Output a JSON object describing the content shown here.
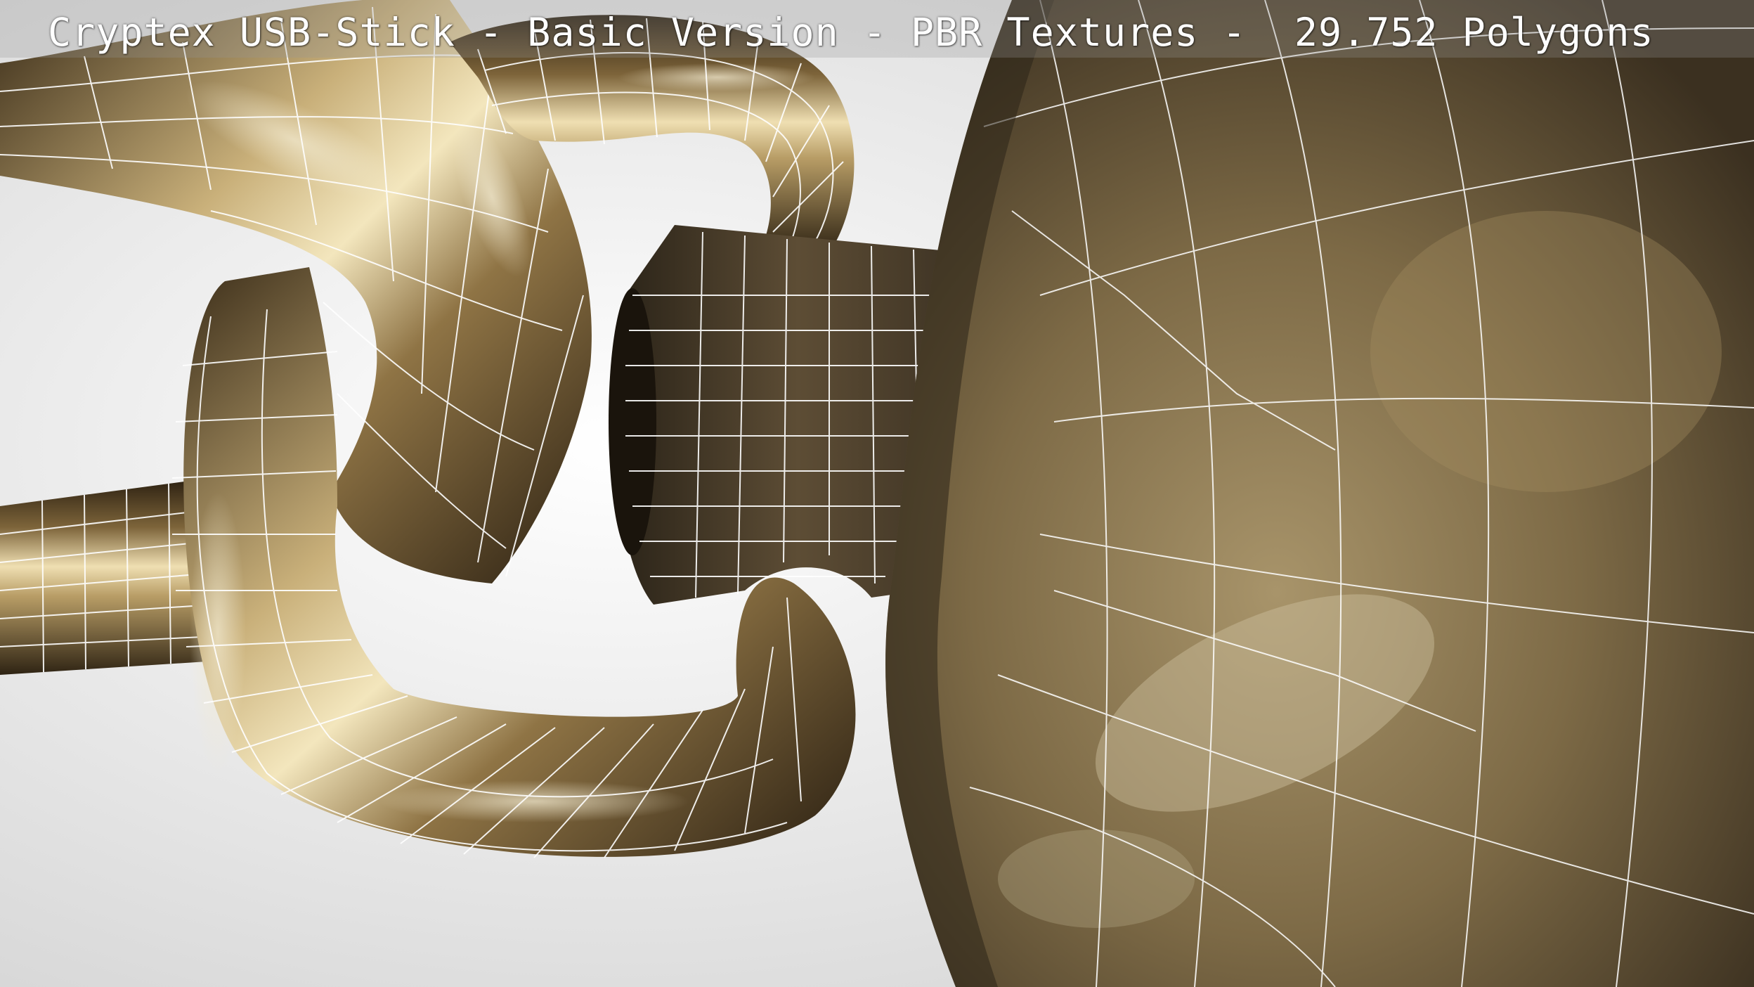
{
  "caption": {
    "text": "Cryptex USB-Stick - Basic Version - PBR Textures -  29.752 Polygons"
  },
  "scene": {
    "subject": "Cryptex USB-Stick",
    "colors": {
      "background": "#e9e9e9",
      "metal_light": "#e8d6a4",
      "metal_mid": "#8a7346",
      "metal_dark": "#2d2214",
      "wireframe": "#ffffff"
    }
  }
}
